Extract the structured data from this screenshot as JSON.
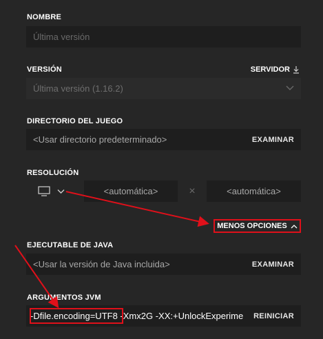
{
  "name": {
    "label": "NOMBRE",
    "placeholder": "Última versión"
  },
  "version": {
    "label": "VERSIÓN",
    "server_label": "SERVIDOR",
    "server_icon": "download-icon",
    "selected": "Última versión (1.16.2)",
    "dropdown_icon": "chevron-down-icon"
  },
  "game_directory": {
    "label": "DIRECTORIO DEL JUEGO",
    "placeholder": "<Usar directorio predeterminado>",
    "browse_label": "EXAMINAR"
  },
  "resolution": {
    "label": "RESOLUCIÓN",
    "monitor_icon": "monitor-icon",
    "width": "<automática>",
    "times": "×",
    "height": "<automática>"
  },
  "more_options": {
    "label": "MENOS OPCIONES"
  },
  "java_executable": {
    "label": "EJECUTABLE DE JAVA",
    "placeholder": "<Usar la versión de Java incluida>",
    "browse_label": "EXAMINAR"
  },
  "jvm_arguments": {
    "label": "ARGUMENTOS JVM",
    "value": "-Dfile.encoding=UTF8 -Xmx2G -XX:+UnlockExperime",
    "highlight": "-Dfile.encoding=UTF8",
    "reset_label": "REINICIAR"
  },
  "colors": {
    "background": "#262626",
    "field": "#1e1e1e",
    "annotation": "#e0101a"
  }
}
